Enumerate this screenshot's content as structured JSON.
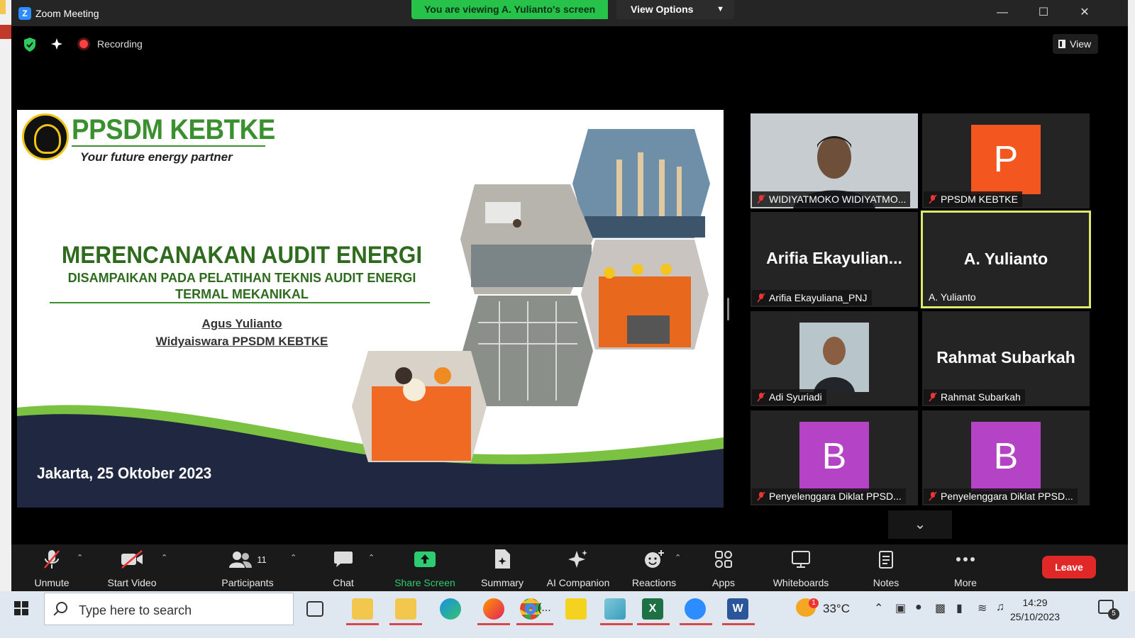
{
  "window": {
    "app_title": "Zoom Meeting"
  },
  "banner": {
    "viewing_text": "You are viewing A. Yulianto's screen",
    "view_options_label": "View Options"
  },
  "topbar": {
    "recording_label": "Recording",
    "view_label": "View"
  },
  "slide": {
    "brand": "PPSDM KEBTKE",
    "tagline": "Your future energy partner",
    "title": "MERENCANAKAN AUDIT ENERGI",
    "subtitle_line1": "DISAMPAIKAN PADA PELATIHAN TEKNIS AUDIT ENERGI",
    "subtitle_line2": "TERMAL MEKANIKAL",
    "author": "Agus Yulianto",
    "role": "Widyaiswara PPSDM KEBTKE",
    "date": "Jakarta, 25 Oktober 2023",
    "colors": {
      "brand_green": "#3a8f2e",
      "wave_green": "#7cc242",
      "navy": "#1f2840"
    }
  },
  "participants": [
    {
      "name": "WIDIYATMOKO WIDIYATMO...",
      "type": "video",
      "muted": true
    },
    {
      "name": "PPSDM KEBTKE",
      "type": "avatar",
      "initial": "P",
      "color": "#f3561f",
      "muted": true
    },
    {
      "name": "Arifia Ekayuliana_PNJ",
      "big_name": "Arifia  Ekayulian...",
      "type": "name",
      "muted": true
    },
    {
      "name": "A. Yulianto",
      "big_name": "A. Yulianto",
      "type": "name",
      "muted": false,
      "active_speaker": true
    },
    {
      "name": "Adi Syuriadi",
      "type": "photo",
      "muted": true
    },
    {
      "name": "Rahmat Subarkah",
      "big_name": "Rahmat Subarkah",
      "type": "name",
      "muted": true
    },
    {
      "name": "Penyelenggara Diklat PPSD...",
      "type": "avatar",
      "initial": "B",
      "color": "#b444c5",
      "muted": true
    },
    {
      "name": "Penyelenggara Diklat PPSD...",
      "type": "avatar",
      "initial": "B",
      "color": "#b444c5",
      "muted": true
    }
  ],
  "toolbar": {
    "unmute": "Unmute",
    "start_video": "Start Video",
    "participants": "Participants",
    "participants_count": "11",
    "chat": "Chat",
    "share_screen": "Share Screen",
    "summary": "Summary",
    "ai_companion": "AI Companion",
    "reactions": "Reactions",
    "apps": "Apps",
    "whiteboards": "Whiteboards",
    "notes": "Notes",
    "more": "More",
    "leave": "Leave"
  },
  "taskbar": {
    "search_placeholder": "Type here to search",
    "weather_temp": "33°C",
    "weather_badge": "1",
    "time": "14:29",
    "date": "25/10/2023",
    "notification_count": "5",
    "chrome_label": "(..."
  }
}
